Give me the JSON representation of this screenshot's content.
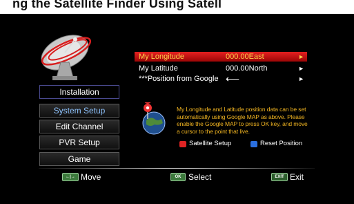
{
  "header": {
    "visible_text": "ng the Satellite Finder Using Satell"
  },
  "tabs": [
    {
      "label": "Installation",
      "active": true
    },
    {
      "label": "System Setup"
    },
    {
      "label": "Edit Channel"
    },
    {
      "label": "PVR Setup"
    },
    {
      "label": "Game"
    }
  ],
  "settings": [
    {
      "label": "My Longitude",
      "value": "000.00East",
      "selected": true
    },
    {
      "label": "My Latitude",
      "value": "000.00North"
    },
    {
      "label": "***Position from Google",
      "value": "⟵"
    }
  ],
  "info_text": "My Longitude and Latitude position data can be set automatically using Google MAP as above. Please enable the Google MAP to press OK key, and move a cursor to the point that live.",
  "keys": {
    "red": {
      "label": "Satellite Setup",
      "color": "#e02424"
    },
    "blue": {
      "label": "Reset Position",
      "color": "#2a6fe0"
    }
  },
  "footer": [
    {
      "button": "←|→",
      "label": "Move"
    },
    {
      "button": "OK",
      "label": "Select"
    },
    {
      "button": "EXIT",
      "label": "Exit"
    }
  ],
  "colors": {
    "selected_row": "#d41414",
    "info_text": "#f2b521"
  }
}
